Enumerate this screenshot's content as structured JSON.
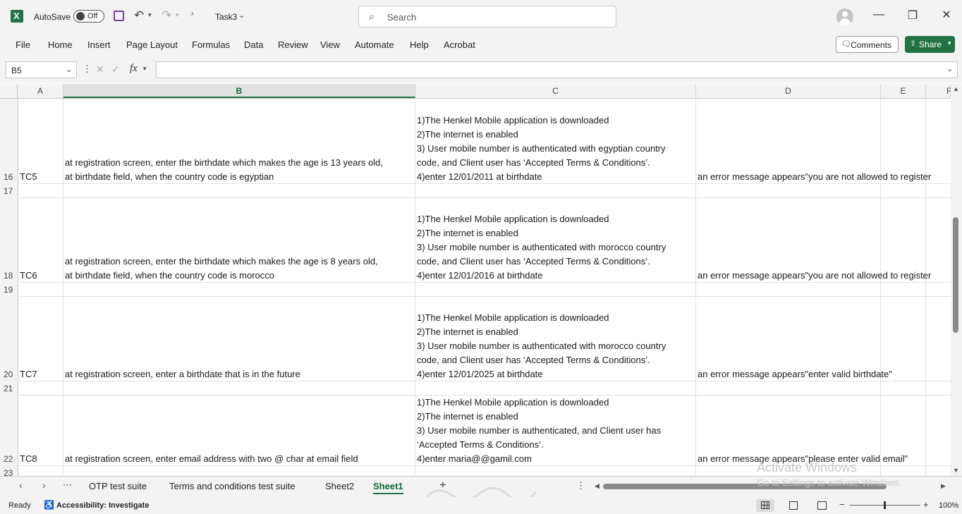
{
  "titlebar": {
    "autosave_label": "AutoSave",
    "autosave_state": "Off",
    "filename": "Task3",
    "search_placeholder": "Search"
  },
  "ribbon": {
    "tabs": [
      "File",
      "Home",
      "Insert",
      "Page Layout",
      "Formulas",
      "Data",
      "Review",
      "View",
      "Automate",
      "Help",
      "Acrobat"
    ],
    "comments_label": "Comments",
    "share_label": "Share"
  },
  "formula_bar": {
    "name_box": "B5",
    "fx_label": "fx",
    "formula": ""
  },
  "columns": [
    "A",
    "B",
    "C",
    "D",
    "E",
    "F"
  ],
  "rows": [
    {
      "num": "16",
      "a": "TC5",
      "b": [
        "at registration screen, enter the birthdate which makes the  age is 13 years old,",
        "at birthdate field, when the country code is egyptian"
      ],
      "c": [
        "1)The Henkel Mobile application is downloaded",
        "2)The internet is enabled",
        "3) User mobile number is authenticated with egyptian country",
        "code, and Client user has ‘Accepted Terms & Conditions’.",
        "4)enter 12/01/2011 at birthdate"
      ],
      "d": "an error message appears\"you are not allowed to register"
    },
    {
      "num": "17"
    },
    {
      "num": "18",
      "a": "TC6",
      "b": [
        "at registration screen, enter the birthdate which makes the  age is 8 years old,",
        "at birthdate field, when the country code is morocco"
      ],
      "c": [
        "1)The Henkel Mobile application is downloaded",
        "2)The internet is enabled",
        "3) User mobile number is authenticated with morocco country",
        "code, and Client user has ‘Accepted Terms & Conditions’.",
        "4)enter 12/01/2016 at birthdate"
      ],
      "d": "an error message appears\"you are not allowed to register"
    },
    {
      "num": "19"
    },
    {
      "num": "20",
      "a": "TC7",
      "b": [
        "at registration screen, enter a birthdate that is in the future"
      ],
      "c": [
        "1)The Henkel Mobile application is downloaded",
        "2)The internet is enabled",
        "3) User mobile number is authenticated with morocco country",
        "code, and Client user has ‘Accepted Terms & Conditions’.",
        "4)enter 12/01/2025 at birthdate"
      ],
      "d": "an error message appears\"enter valid birthdate\""
    },
    {
      "num": "21"
    },
    {
      "num": "22",
      "a": "TC8",
      "b": [
        "at registration screen, enter email address with two @ char at email field"
      ],
      "c": [
        "1)The Henkel Mobile application is downloaded",
        "2)The internet is enabled",
        "3) User mobile number is authenticated, and Client user has",
        "‘Accepted Terms & Conditions’.",
        "4)enter maria@@gamil.com"
      ],
      "d": "an error message appears\"please enter valid email\""
    },
    {
      "num": "23"
    }
  ],
  "sheet_tabs": [
    "OTP test suite",
    "Terms and conditions test suite",
    "Sheet2",
    "Sheet1"
  ],
  "active_sheet": "Sheet1",
  "status": {
    "ready": "Ready",
    "accessibility": "Accessibility: Investigate",
    "zoom": "100%"
  },
  "watermark": {
    "line1": "Activate Windows",
    "line2": "Go to Settings to activate Windows."
  },
  "colors": {
    "excel_green": "#217346"
  }
}
